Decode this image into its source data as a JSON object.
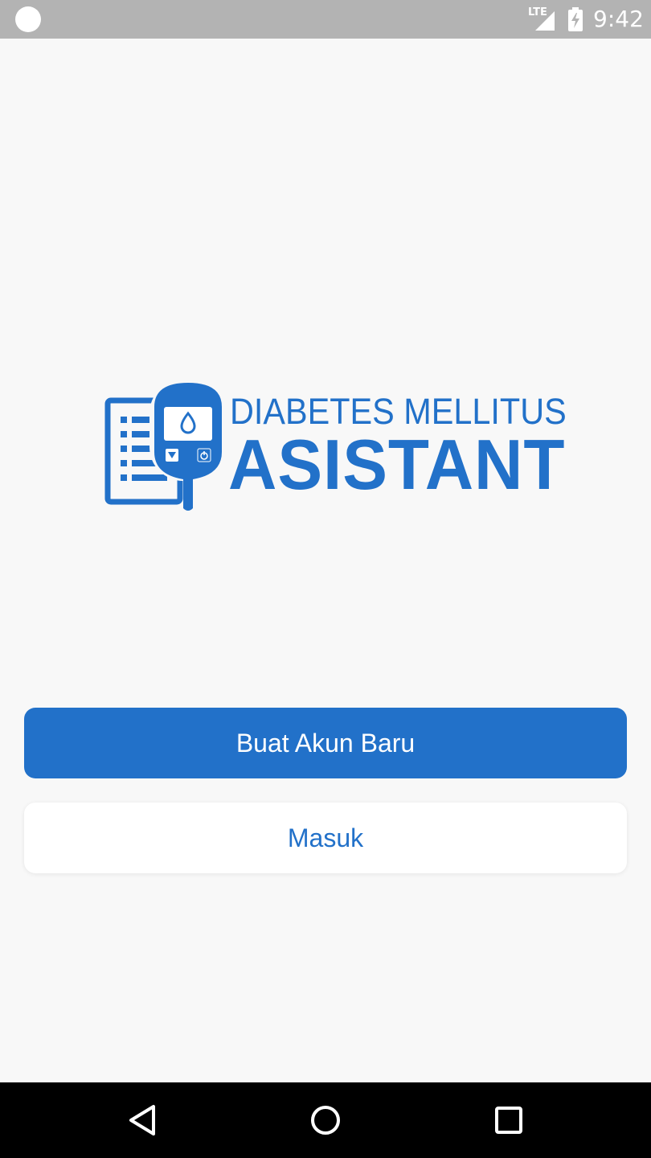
{
  "status_bar": {
    "network": "LTE",
    "time": "9:42",
    "icons": [
      "notification-dot-icon",
      "signal-icon",
      "battery-charging-icon"
    ]
  },
  "logo": {
    "line1": "DIABETES MELLITUS",
    "line2": "ASISTANT",
    "icon": "glucose-meter-icon",
    "color": "#2271c9"
  },
  "buttons": {
    "create_account": "Buat Akun Baru",
    "login": "Masuk"
  },
  "nav_bar": {
    "icons": [
      "back-icon",
      "home-icon",
      "recent-apps-icon"
    ]
  },
  "colors": {
    "primary": "#2271c9",
    "background": "#f8f8f8",
    "status_bar": "#b3b3b3",
    "nav_bar": "#000000"
  }
}
